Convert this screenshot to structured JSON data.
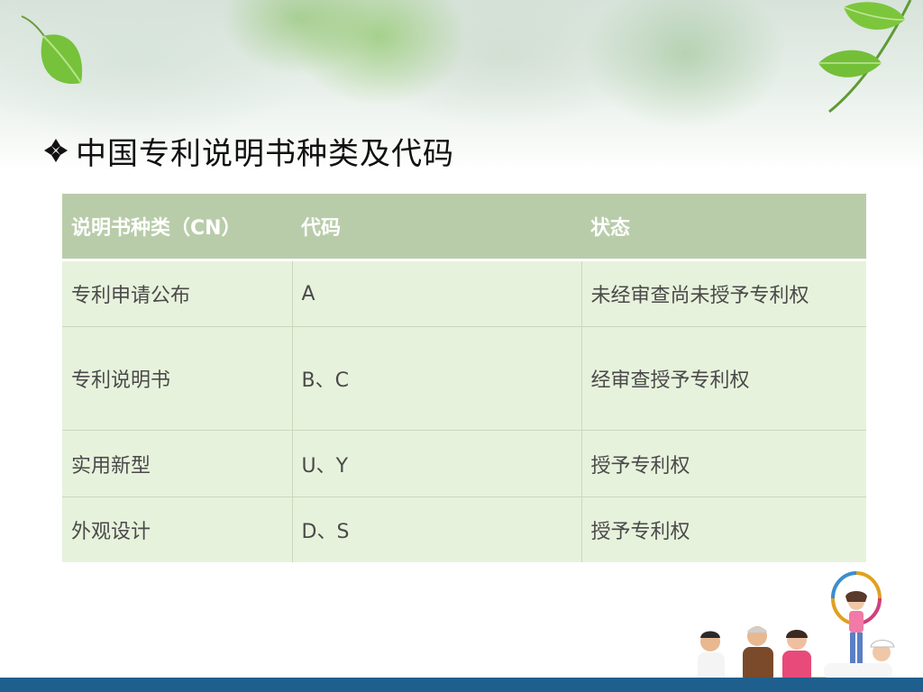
{
  "slide": {
    "title": "中国专利说明书种类及代码",
    "colors": {
      "header_fill": "#b9ccaa",
      "row_fill": "#e7f2dc",
      "bottom_bar": "#1f5f8e",
      "leaf_green": "#6cbf2e"
    }
  },
  "table": {
    "headers": [
      "说明书种类（CN）",
      "代码",
      "状态"
    ],
    "rows": [
      [
        "专利申请公布",
        "A",
        "未经审查尚未授予专利权"
      ],
      [
        "专利说明书",
        "B、C",
        "经审查授予专利权"
      ],
      [
        "实用新型",
        "U、Y",
        "授予专利权"
      ],
      [
        "外观设计",
        "D、S",
        "授予专利权"
      ]
    ]
  },
  "decor": {
    "icons": [
      "leaf-icon",
      "diamond-bullet-icon"
    ],
    "photo": "family-outdoor-photo"
  }
}
